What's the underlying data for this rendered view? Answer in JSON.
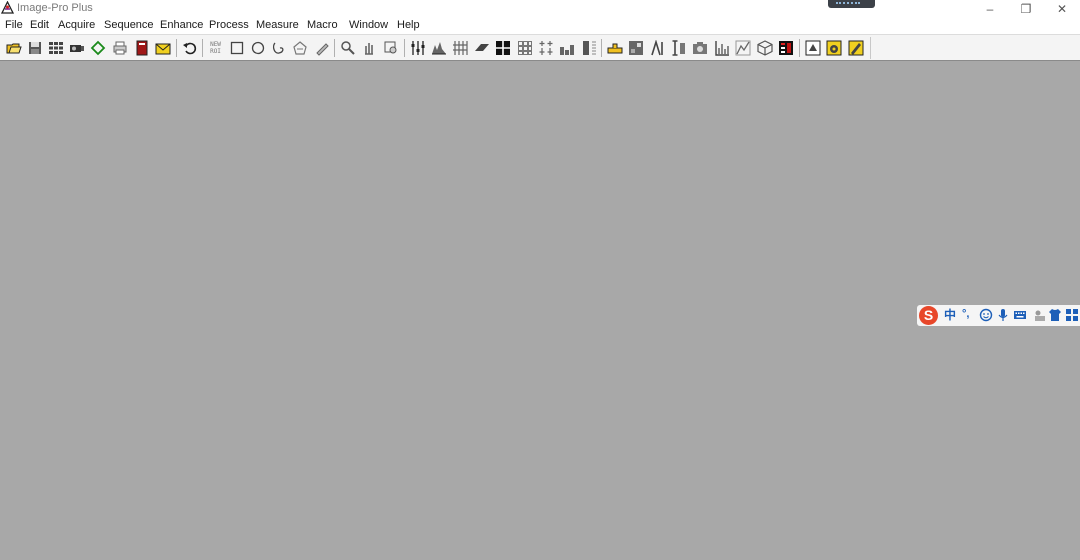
{
  "window": {
    "title": "Image-Pro Plus",
    "minimize_glyph": "–",
    "restore_glyph": "❐",
    "close_glyph": "✕"
  },
  "menu": [
    "File",
    "Edit",
    "Acquire",
    "Sequence",
    "Enhance",
    "Process",
    "Measure",
    "Macro",
    "Window",
    "Help"
  ],
  "toolbar": {
    "roi_label_top": "NEW",
    "roi_label_bottom": "ROI",
    "buttons": [
      "open-icon",
      "save-icon",
      "thumbnails-icon",
      "camera-icon",
      "aoi-icon",
      "print-icon",
      "book-icon",
      "mail-icon",
      "undo-icon",
      "new-roi-icon",
      "rectangle-icon",
      "ellipse-icon",
      "freehand-icon",
      "polygon-icon",
      "pencil-icon",
      "zoom-icon",
      "pan-icon",
      "magnify-icon",
      "sliders-icon",
      "histogram-icon",
      "filter-icon",
      "plane-icon",
      "grid-icon",
      "tiles-icon",
      "spatial-icon",
      "bar-graph-icon",
      "column-icon",
      "ruler-icon",
      "calibrate-icon",
      "profile-icon",
      "line-measure-icon",
      "snapshot-icon",
      "hist-icon",
      "segment-icon",
      "3d-cube-icon",
      "color-icon",
      "macro-icon",
      "macro-run-icon",
      "macro-edit-icon"
    ]
  },
  "ime": {
    "logo": "S",
    "mode": "中",
    "punctuation": "°,"
  },
  "colors": {
    "workspace": "#a8a8a8",
    "toolbar": "#f4f4f4",
    "ime_logo": "#e8472a",
    "ime_blue": "#1d5fb8"
  }
}
